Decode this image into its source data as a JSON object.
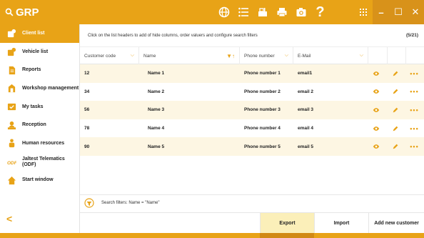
{
  "app": {
    "title": "GRP"
  },
  "header": {
    "icons": [
      "web-icon",
      "list-icon",
      "cash-register-icon",
      "printer-icon",
      "camera-icon",
      "help-icon",
      "grid-menu-icon"
    ],
    "help_glyph": "?",
    "window": {
      "minimize": "–",
      "maximize": "☐",
      "close": "✕"
    }
  },
  "sidebar": {
    "items": [
      {
        "label": "Client list",
        "icon": "client-icon",
        "active": true
      },
      {
        "label": "Vehicle list",
        "icon": "vehicle-icon",
        "active": false
      },
      {
        "label": "Reports",
        "icon": "reports-icon",
        "active": false
      },
      {
        "label": "Workshop management",
        "icon": "workshop-icon",
        "active": false
      },
      {
        "label": "My tasks",
        "icon": "tasks-icon",
        "active": false
      },
      {
        "label": "Reception",
        "icon": "reception-icon",
        "active": false
      },
      {
        "label": "Human resources",
        "icon": "human-resources-icon",
        "active": false
      },
      {
        "label": "Jaltest Telematics (ODF)",
        "icon": "odf-icon",
        "active": false
      },
      {
        "label": "Start window",
        "icon": "home-icon",
        "active": false
      }
    ],
    "back_glyph": "<"
  },
  "main": {
    "hint": "Click on the list headers to add of hide columns, order valuers and configure search filters",
    "count": "(5/21)",
    "columns": [
      {
        "label": "Customer code"
      },
      {
        "label": "Name"
      },
      {
        "label": "Phone number"
      },
      {
        "label": "E-Mail"
      }
    ],
    "rows": [
      {
        "code": "12",
        "name": "Name 1",
        "phone": "Phone number 1",
        "email": "email1"
      },
      {
        "code": "34",
        "name": "Name 2",
        "phone": "Phone number 2",
        "email": "email 2"
      },
      {
        "code": "56",
        "name": "Name 3",
        "phone": "Phone number 3",
        "email": "email 3"
      },
      {
        "code": "78",
        "name": "Name 4",
        "phone": "Phone number 4",
        "email": "email 4"
      },
      {
        "code": "90",
        "name": "Name 5",
        "phone": "Phone number 5",
        "email": "email 5"
      }
    ],
    "more_glyph": "•••",
    "filter_text": "Search filters: Name = \"Name\"",
    "buttons": {
      "export": "Export",
      "import": "Import",
      "add": "Add new customer"
    }
  },
  "colors": {
    "accent": "#e8a317",
    "row_highlight": "#fdf6e3",
    "button_highlight": "#fbefb9"
  }
}
